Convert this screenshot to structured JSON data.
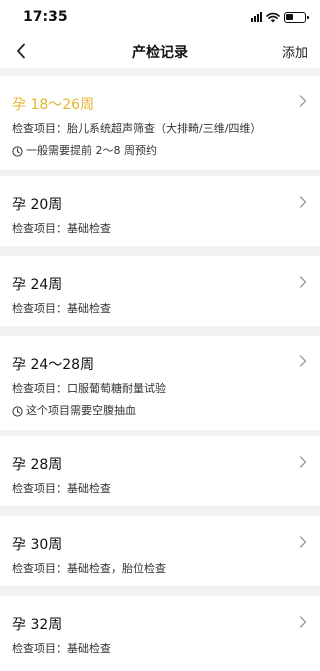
{
  "status_bar": {
    "time": "17:35"
  },
  "nav": {
    "back_icon": "chevron-left-icon",
    "title": "产检记录",
    "add_label": "添加"
  },
  "records": [
    {
      "title": "孕 18～26周",
      "highlight": true,
      "item": "检查项目：胎儿系统超声筛查（大排畸/三维/四维）",
      "note": "一般需要提前 2～8 周预约"
    },
    {
      "title": "孕 20周",
      "highlight": false,
      "item": "检查项目：基础检查",
      "note": ""
    },
    {
      "title": "孕 24周",
      "highlight": false,
      "item": "检查项目：基础检查",
      "note": ""
    },
    {
      "title": "孕 24～28周",
      "highlight": false,
      "item": "检查项目：口服葡萄糖耐量试验",
      "note": "这个项目需要空腹抽血"
    },
    {
      "title": "孕 28周",
      "highlight": false,
      "item": "检查项目：基础检查",
      "note": ""
    },
    {
      "title": "孕 30周",
      "highlight": false,
      "item": "检查项目：基础检查，胎位检查",
      "note": ""
    },
    {
      "title": "孕 32周",
      "highlight": false,
      "item": "检查项目：基础检查",
      "note": ""
    }
  ],
  "colors": {
    "highlight": "#e8b532",
    "background": "#f2f2f2",
    "card": "#ffffff"
  }
}
